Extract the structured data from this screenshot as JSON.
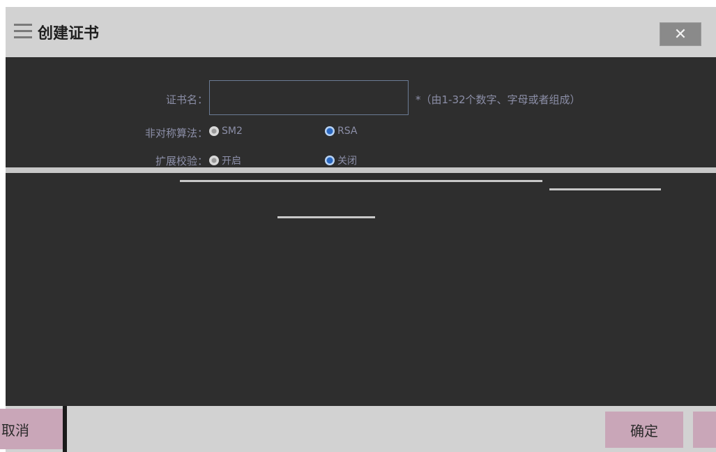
{
  "dialog": {
    "title": "创建证书",
    "close_symbol": "✕"
  },
  "form": {
    "name_label": "证书名：",
    "name_value": "",
    "name_hint": "*（由1-32个数字、字母或者组成）",
    "algorithm_label": "非对称算法：",
    "algorithm_options": [
      {
        "label": "SM2",
        "checked": false
      },
      {
        "label": "RSA",
        "checked": true
      }
    ],
    "ext_label": "扩展校验：",
    "ext_options": [
      {
        "label": "开启",
        "checked": false
      },
      {
        "label": "关闭",
        "checked": true
      }
    ]
  },
  "footer": {
    "cancel_label": "取消",
    "ok_label": "确定"
  },
  "colors": {
    "panel": "#2e2e2e",
    "header": "#d2d2d2",
    "button": "#c9a6b8",
    "label_text": "#8c8fa8"
  }
}
